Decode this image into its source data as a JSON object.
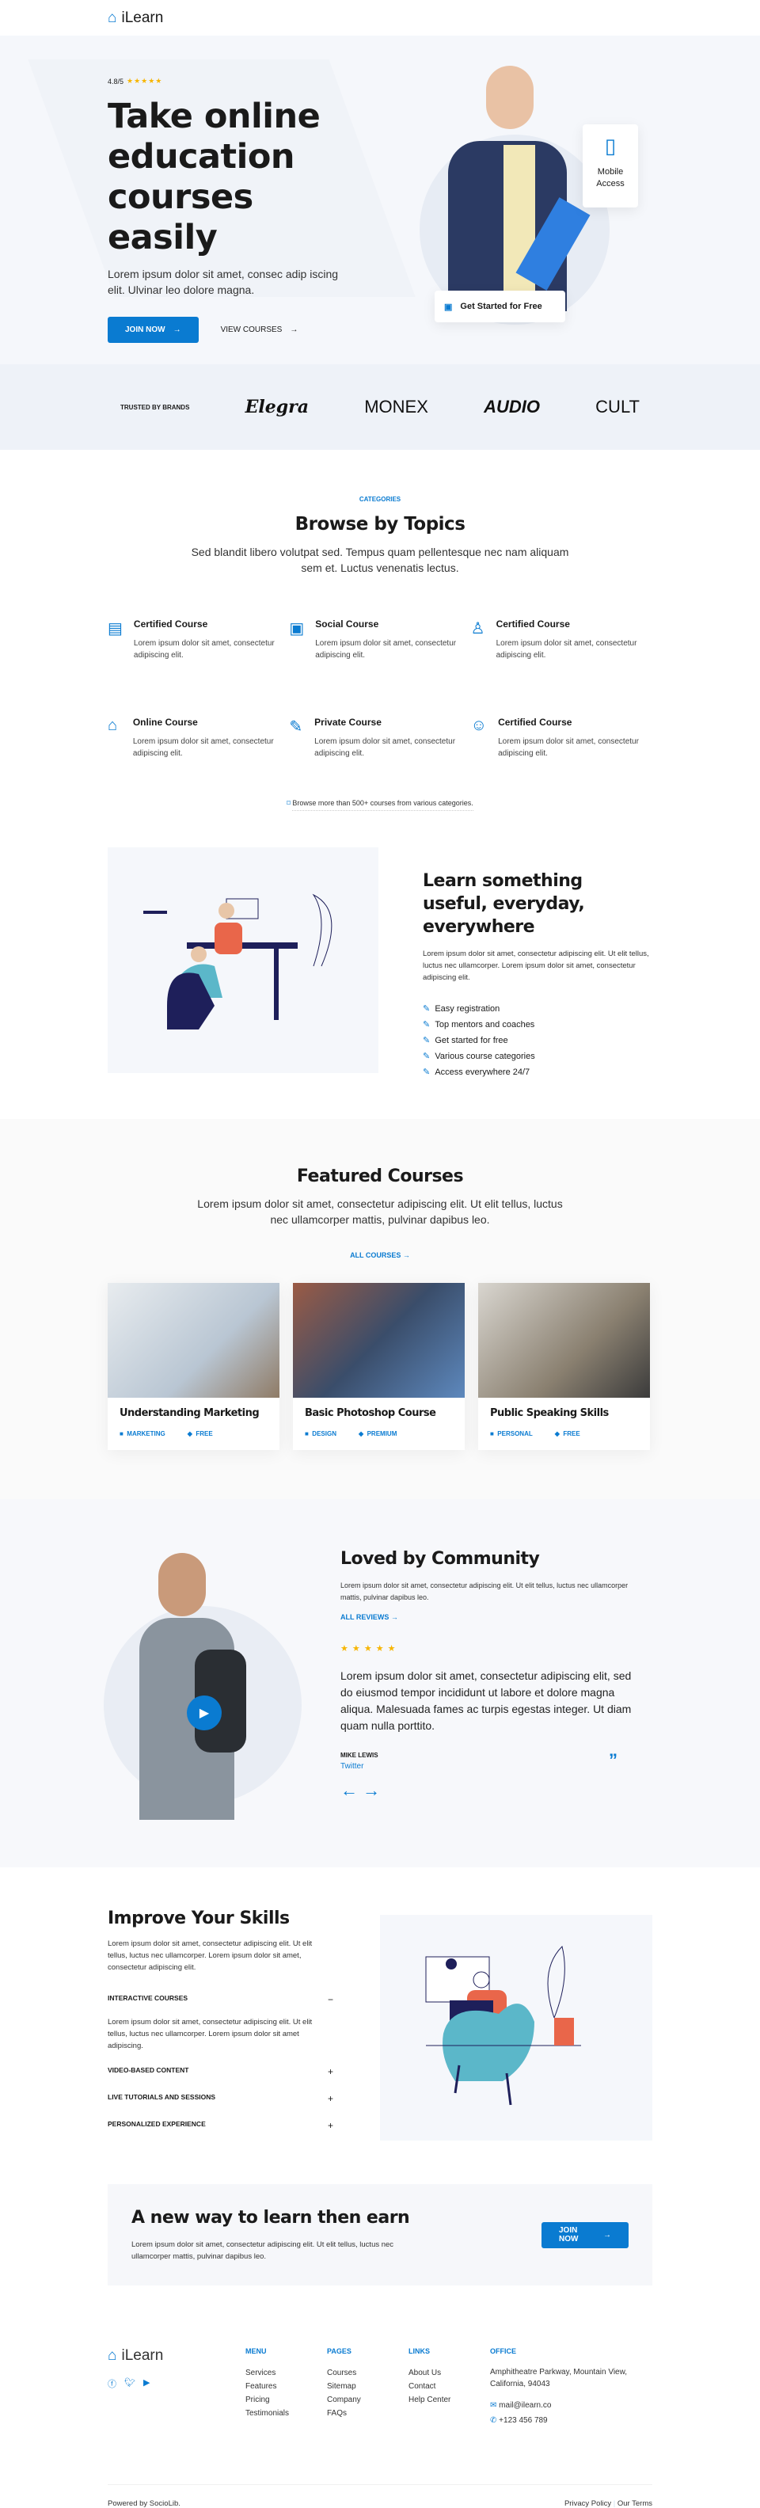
{
  "brand": {
    "name": "iLearn",
    "accent": "#0a7bd1",
    "star": "#f7b500"
  },
  "hero": {
    "rating": "4.8/5",
    "stars": "★★★★★",
    "title": "Take online education courses easily",
    "text": "Lorem ipsum dolor sit amet, consec adip iscing elit. Ulvinar leo dolore magna.",
    "join": "JOIN NOW",
    "view": "VIEW COURSES",
    "mobile": "Mobile Access",
    "started": "Get Started for Free"
  },
  "brands": {
    "label": "TRUSTED BY BRANDS",
    "items": [
      "Elegra",
      "MONEX",
      "AUDIO",
      "CULT"
    ]
  },
  "topics": {
    "eyebrow": "CATEGORIES",
    "title": "Browse by Topics",
    "text": "Sed blandit libero volutpat sed. Tempus quam pellentesque nec nam aliquam sem et. Luctus venenatis lectus.",
    "items": [
      {
        "title": "Certified Course",
        "text": "Lorem ipsum dolor sit amet, consectetur adipiscing elit.",
        "icon": "certificate-icon"
      },
      {
        "title": "Social Course",
        "text": "Lorem ipsum dolor sit amet, consectetur adipiscing elit.",
        "icon": "chat-book-icon"
      },
      {
        "title": "Certified Course",
        "text": "Lorem ipsum dolor sit amet, consectetur adipiscing elit.",
        "icon": "graduate-icon"
      },
      {
        "title": "Online Course",
        "text": "Lorem ipsum dolor sit amet, consectetur adipiscing elit.",
        "icon": "home-book-icon"
      },
      {
        "title": "Private Course",
        "text": "Lorem ipsum dolor sit amet, consectetur adipiscing elit.",
        "icon": "ruler-pencil-icon"
      },
      {
        "title": "Certified Course",
        "text": "Lorem ipsum dolor sit amet, consectetur adipiscing elit.",
        "icon": "reader-icon"
      }
    ],
    "more": "Browse more than 500+ courses from various categories."
  },
  "learn": {
    "title": "Learn something useful, everyday, everywhere",
    "text": "Lorem ipsum dolor sit amet, consectetur adipiscing elit. Ut elit tellus, luctus nec ullamcorper. Lorem ipsum dolor sit amet, consectetur adipiscing elit.",
    "list": [
      "Easy registration",
      "Top mentors and coaches",
      "Get started for free",
      "Various course categories",
      "Access everywhere 24/7"
    ]
  },
  "featured": {
    "title": "Featured Courses",
    "text": "Lorem ipsum dolor sit amet, consectetur adipiscing elit. Ut elit tellus, luctus nec ullamcorper mattis, pulvinar dapibus leo.",
    "all": "ALL COURSES",
    "cards": [
      {
        "title": "Understanding Marketing",
        "cat": "MARKETING",
        "price": "FREE"
      },
      {
        "title": "Basic Photoshop Course",
        "cat": "DESIGN",
        "price": "PREMIUM"
      },
      {
        "title": "Public Speaking Skills",
        "cat": "PERSONAL",
        "price": "FREE"
      }
    ]
  },
  "community": {
    "title": "Loved by Community",
    "text": "Lorem ipsum dolor sit amet, consectetur adipiscing elit. Ut elit tellus, luctus nec ullamcorper mattis, pulvinar dapibus leo.",
    "all": "ALL REVIEWS",
    "stars": "★ ★ ★ ★ ★",
    "quote": "Lorem ipsum dolor sit amet, consectetur adipiscing elit, sed do eiusmod tempor incididunt ut labore et dolore magna aliqua. Malesuada fames ac turpis egestas integer. Ut diam quam nulla porttito.",
    "name": "MIKE LEWIS",
    "source": "Twitter"
  },
  "skills": {
    "title": "Improve Your Skills",
    "text": "Lorem ipsum dolor sit amet, consectetur adipiscing elit. Ut elit tellus, luctus nec ullamcorper. Lorem ipsum dolor sit amet, consectetur adipiscing elit.",
    "acc": [
      {
        "title": "INTERACTIVE COURSES",
        "open": true,
        "text": "Lorem ipsum dolor sit amet, consectetur adipiscing elit. Ut elit tellus, luctus nec ullamcorper. Lorem ipsum dolor sit amet adipiscing."
      },
      {
        "title": "VIDEO-BASED CONTENT",
        "open": false
      },
      {
        "title": "LIVE TUTORIALS AND SESSIONS",
        "open": false
      },
      {
        "title": "PERSONALIZED EXPERIENCE",
        "open": false
      }
    ]
  },
  "cta": {
    "title": "A new way to learn then earn",
    "text": "Lorem ipsum dolor sit amet, consectetur adipiscing elit. Ut elit tellus, luctus nec ullamcorper mattis, pulvinar dapibus leo.",
    "button": "JOIN NOW"
  },
  "footer": {
    "cols": [
      {
        "title": "MENU",
        "items": [
          "Services",
          "Features",
          "Pricing",
          "Testimonials"
        ]
      },
      {
        "title": "PAGES",
        "items": [
          "Courses",
          "Sitemap",
          "Company",
          "FAQs"
        ]
      },
      {
        "title": "LINKS",
        "items": [
          "About Us",
          "Contact",
          "Help Center"
        ]
      }
    ],
    "office": {
      "title": "OFFICE",
      "address": "Amphitheatre Parkway, Mountain View, California, 94043",
      "email": "mail@ilearn.co",
      "phone": "+123 456 789"
    },
    "powered": "Powered by SocioLib.",
    "privacy": "Privacy Policy",
    "terms": "Our Terms"
  }
}
